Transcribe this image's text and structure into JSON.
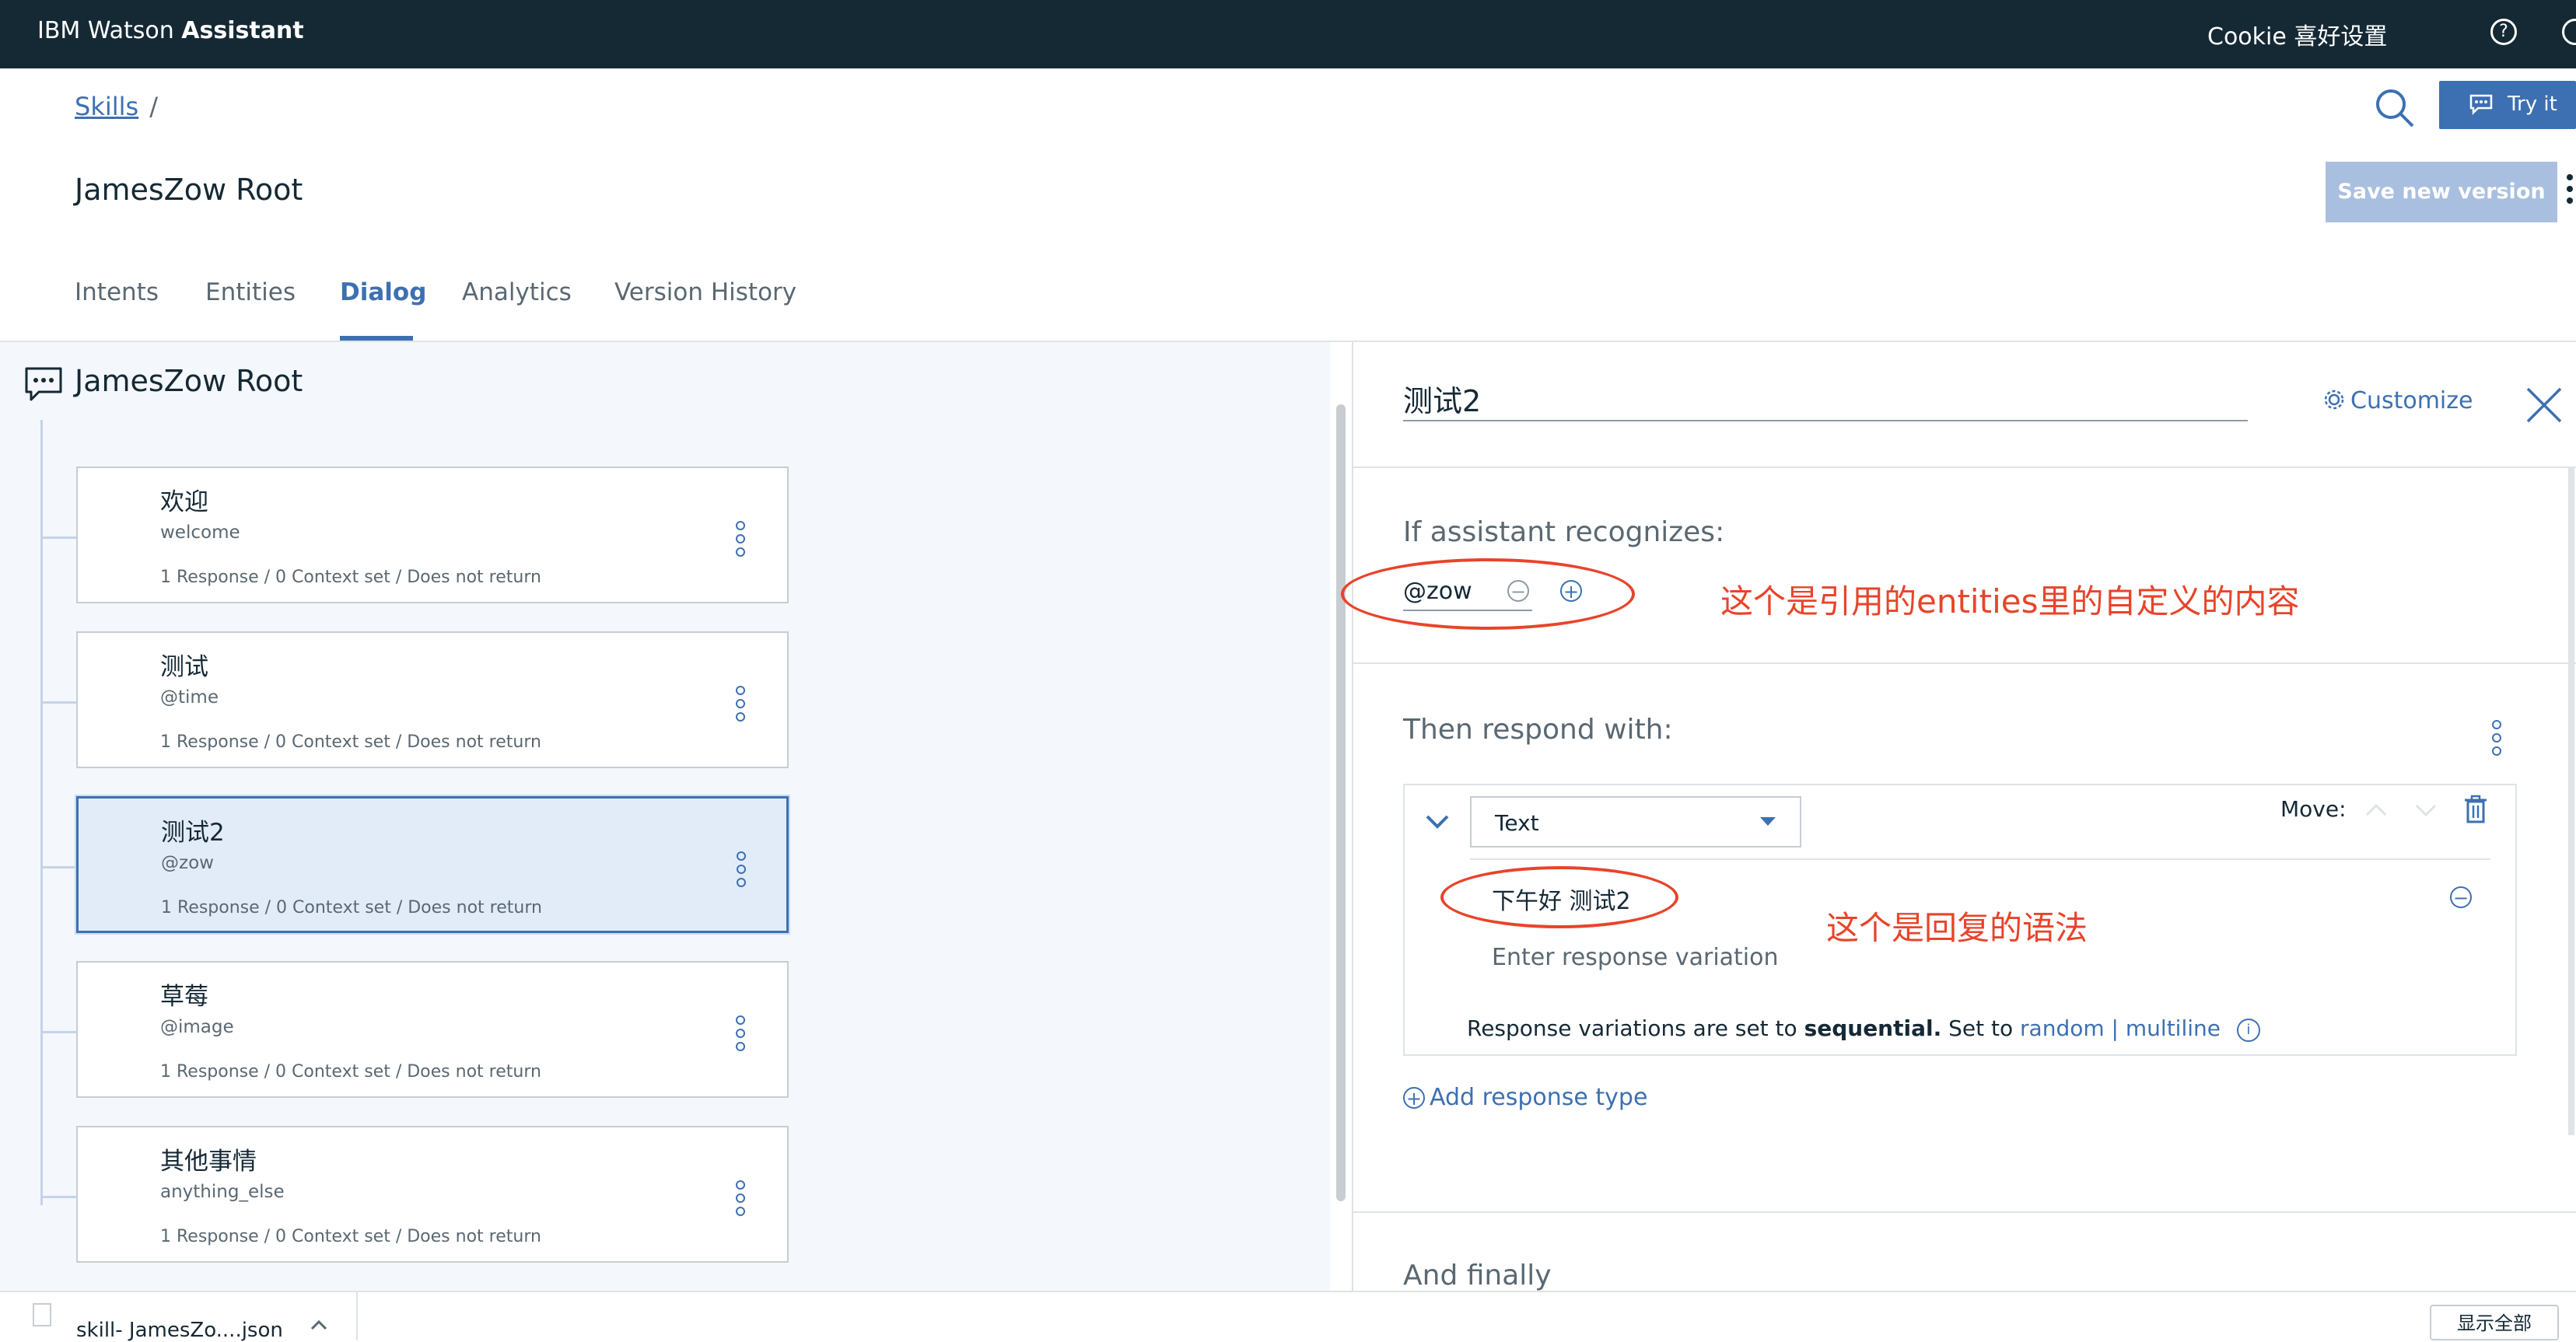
{
  "topbar": {
    "brand_prefix": "IBM Watson ",
    "brand_bold": "Assistant",
    "user": "Cookie 喜好设置",
    "help_icon": "question-circle-icon",
    "profile_icon": "user-circle-icon"
  },
  "header": {
    "breadcrumb": "Skills",
    "breadcrumb_sep": "/",
    "skill_title": "JamesZow Root",
    "try_it_label": "Try it",
    "save_label": "Save new version"
  },
  "tabs": [
    {
      "label": "Intents"
    },
    {
      "label": "Entities"
    },
    {
      "label": "Dialog"
    },
    {
      "label": "Analytics"
    },
    {
      "label": "Version History"
    }
  ],
  "dialog_tree": {
    "root_title": "JamesZow Root",
    "nodes": [
      {
        "name": "欢迎",
        "condition": "welcome",
        "meta": "1 Response / 0 Context set / Does not return"
      },
      {
        "name": "测试",
        "condition": "@time",
        "meta": "1 Response / 0 Context set / Does not return"
      },
      {
        "name": "测试2",
        "condition": "@zow",
        "meta": "1 Response / 0 Context set / Does not return"
      },
      {
        "name": "草莓",
        "condition": "@image",
        "meta": "1 Response / 0 Context set / Does not return"
      },
      {
        "name": "其他事情",
        "condition": "anything_else",
        "meta": "1 Response / 0 Context set / Does not return"
      }
    ]
  },
  "editor": {
    "node_name": "测试2",
    "customize_label": "Customize",
    "if_label": "If assistant recognizes:",
    "condition_value": "@zow",
    "condition_annotation": "这个是引用的entities里的自定义的内容",
    "respond_label": "Then respond with:",
    "response_type": "Text",
    "move_label": "Move:",
    "response_text": "下午好 测试2",
    "response_annotation": "这个是回复的语法",
    "variation_placeholder": "Enter response variation",
    "variations_prefix": "Response variations are set to ",
    "variations_mode": "sequential.",
    "variations_set_to": " Set to ",
    "random_label": "random",
    "pipe": "|",
    "multiline_label": "multiline",
    "add_response_label": "Add response type",
    "finally_label": "And finally"
  },
  "downloads": {
    "file_name": "skill- JamesZo....json",
    "show_all": "显示全部"
  },
  "colors": {
    "topbar_bg": "#152935",
    "accent": "#3d70b2",
    "annotation": "#e8442a"
  }
}
